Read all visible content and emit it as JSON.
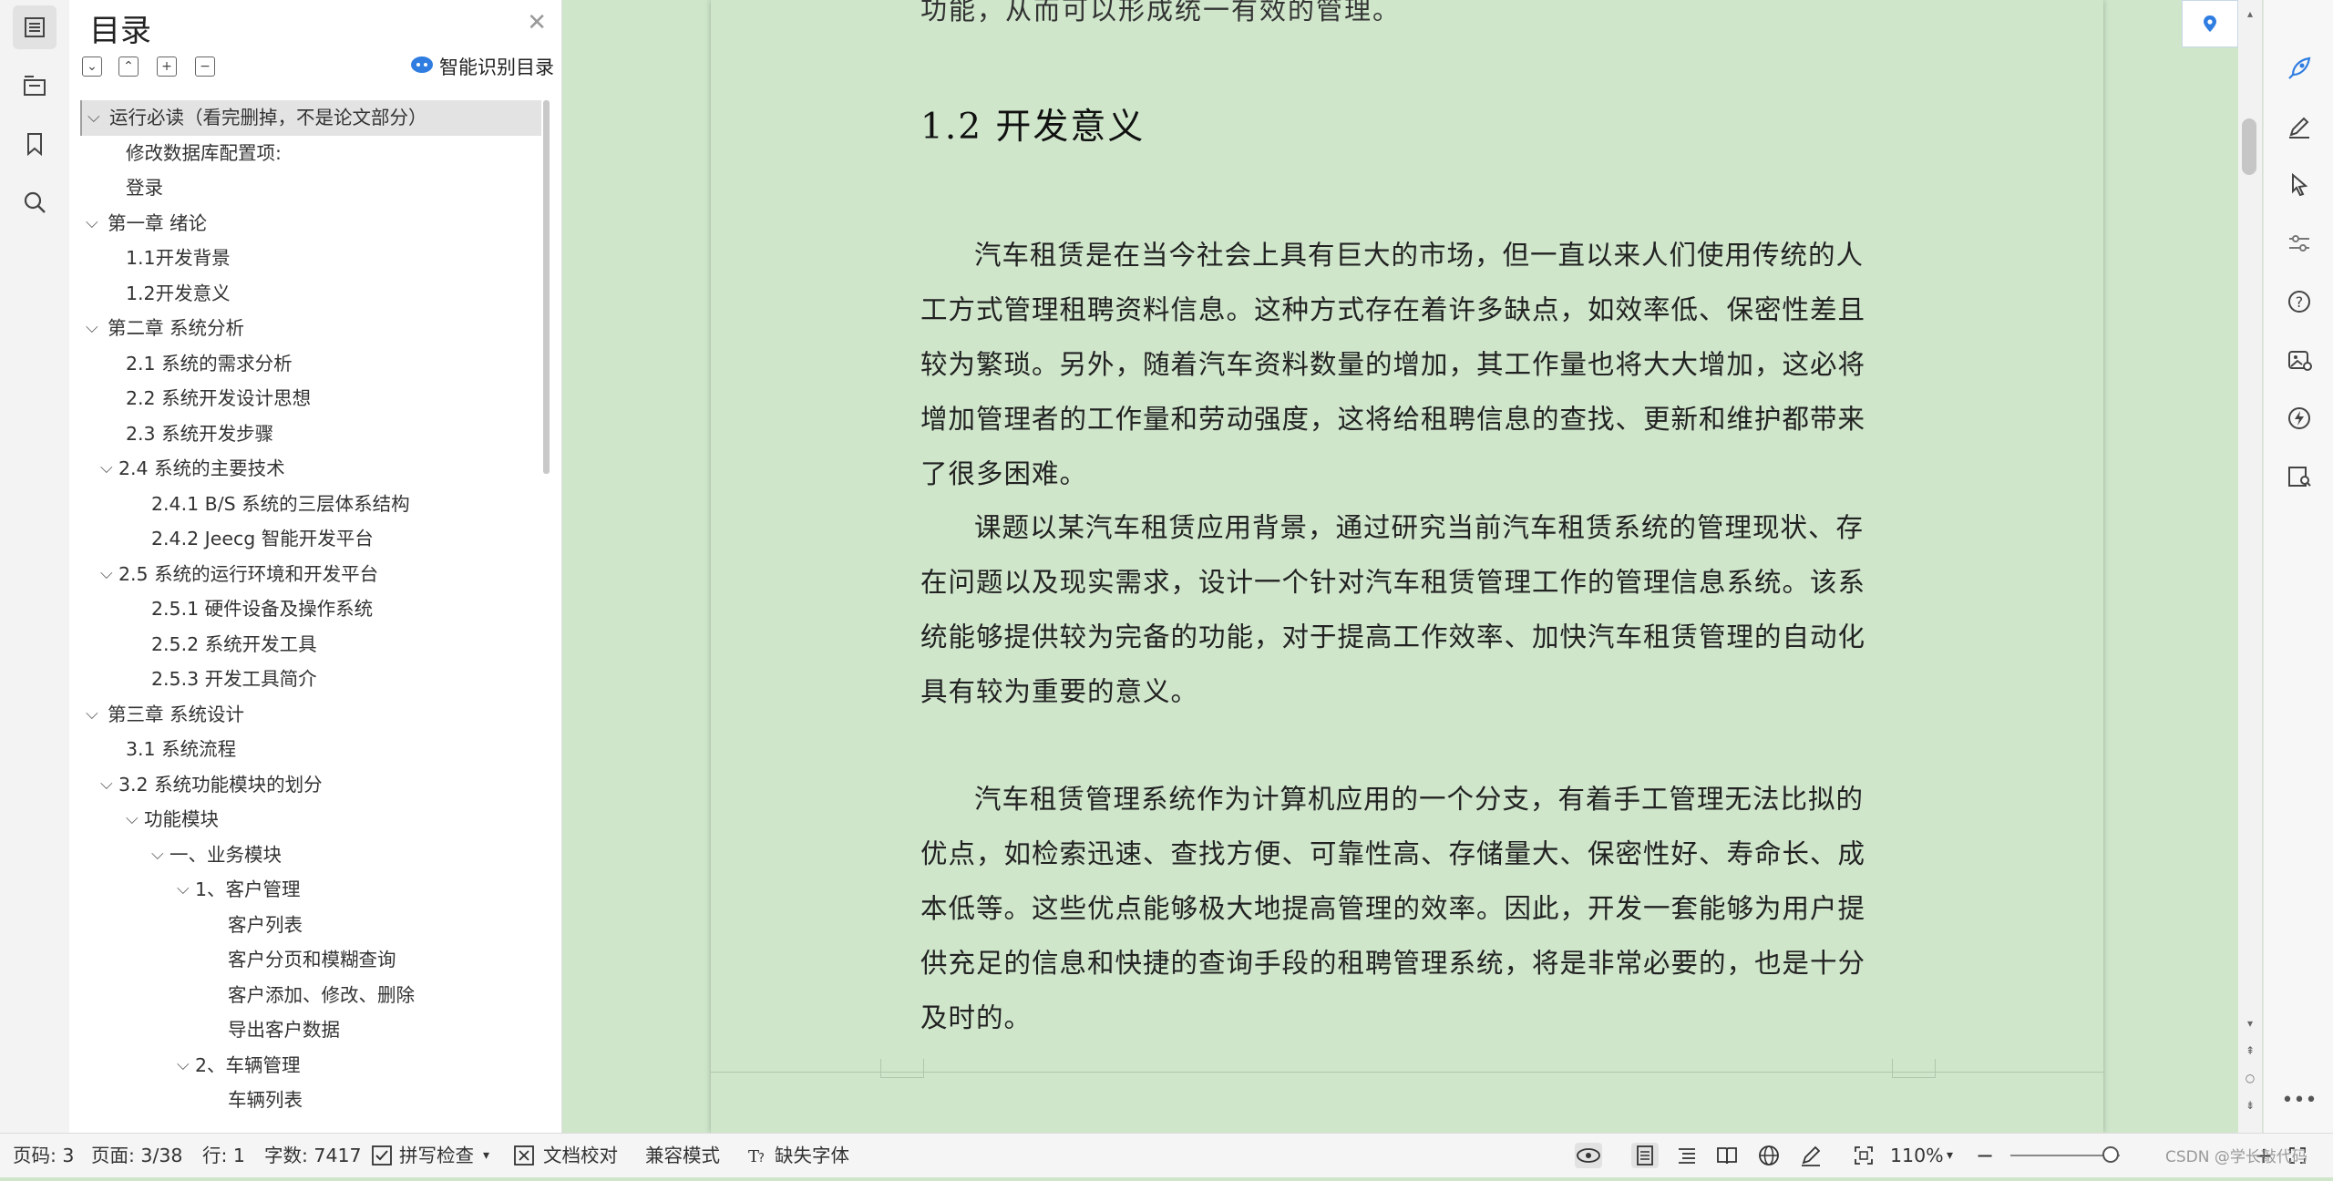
{
  "toc_panel": {
    "title": "目录",
    "smart_toc_label": "智能识别目录",
    "items": [
      {
        "label": "运行必读（看完删掉，不是论文部分）",
        "level": 0,
        "expanded": true,
        "selected": true
      },
      {
        "label": "修改数据库配置项:",
        "level": 1
      },
      {
        "label": "登录",
        "level": 1
      },
      {
        "label": "第一章  绪论",
        "level": 0,
        "expanded": true
      },
      {
        "label": "1.1开发背景",
        "level": 1
      },
      {
        "label": "1.2开发意义",
        "level": 1
      },
      {
        "label": "第二章  系统分析",
        "level": 0,
        "expanded": true
      },
      {
        "label": "2.1  系统的需求分析",
        "level": 1
      },
      {
        "label": "2.2  系统开发设计思想",
        "level": 1
      },
      {
        "label": "2.3 系统开发步骤",
        "level": 1
      },
      {
        "label": "2.4  系统的主要技术",
        "level": 1,
        "expanded": true
      },
      {
        "label": "2.4.1 B/S 系统的三层体系结构",
        "level": 2
      },
      {
        "label": "2.4.2 Jeecg  智能开发平台",
        "level": 2
      },
      {
        "label": "2.5  系统的运行环境和开发平台",
        "level": 1,
        "expanded": true
      },
      {
        "label": "2.5.1  硬件设备及操作系统",
        "level": 2
      },
      {
        "label": "2.5.2  系统开发工具",
        "level": 2
      },
      {
        "label": "2.5.3  开发工具简介",
        "level": 2
      },
      {
        "label": "第三章  系统设计",
        "level": 0,
        "expanded": true
      },
      {
        "label": "3.1 系统流程",
        "level": 1
      },
      {
        "label": "3.2  系统功能模块的划分",
        "level": 1,
        "expanded": true
      },
      {
        "label": "功能模块",
        "level": 2,
        "expanded": true
      },
      {
        "label": "一、业务模块",
        "level": 3,
        "expanded": true
      },
      {
        "label": "1、客户管理",
        "level": 4,
        "expanded": true
      },
      {
        "label": "客户列表",
        "level": 5
      },
      {
        "label": "客户分页和模糊查询",
        "level": 5
      },
      {
        "label": "客户添加、修改、删除",
        "level": 5
      },
      {
        "label": "导出客户数据",
        "level": 5
      },
      {
        "label": "2、车辆管理",
        "level": 4,
        "expanded": true
      },
      {
        "label": "车辆列表",
        "level": 5
      }
    ]
  },
  "document": {
    "cut_line": "功能，从而可以形成统一有效的管理。",
    "section_heading": "1.2  开发意义",
    "paragraphs": [
      "汽车租赁是在当今社会上具有巨大的市场，但一直以来人们使用传统的人工方式管理租聘资料信息。这种方式存在着许多缺点，如效率低、保密性差且较为繁琐。另外，随着汽车资料数量的增加，其工作量也将大大增加，这必将增加管理者的工作量和劳动强度，这将给租聘信息的查找、更新和维护都带来了很多困难。",
      "课题以某汽车租赁应用背景，通过研究当前汽车租赁系统的管理现状、存在问题以及现实需求，设计一个针对汽车租赁管理工作的管理信息系统。该系统能够提供较为完备的功能，对于提高工作效率、加快汽车租赁管理的自动化具有较为重要的意义。",
      "汽车租赁管理系统作为计算机应用的一个分支，有着手工管理无法比拟的优点，如检索迅速、查找方便、可靠性高、存储量大、保密性好、寿命长、成本低等。这些优点能够极大地提高管理的效率。因此，开发一套能够为用户提供充足的信息和快捷的查询手段的租聘管理系统，将是非常必要的，也是十分及时的。"
    ]
  },
  "status_bar": {
    "page_code": "页码: 3",
    "page": "页面: 3/38",
    "row": "行: 1",
    "word_count": "字数: 7417",
    "spell_check": "拼写检查",
    "doc_proof": "文档校对",
    "compat_mode": "兼容模式",
    "missing_font": "缺失字体",
    "zoom": "110%",
    "zoom_fraction": 0.92,
    "watermark": "CSDN @学长敲代码"
  },
  "colors": {
    "page_background": "#cfe6cb",
    "accent": "#2f7de1"
  },
  "icons": {
    "left_rail": [
      "toc-icon",
      "navigation-icon",
      "bookmark-icon",
      "search-icon"
    ],
    "right_rail": [
      "rocket-icon",
      "pen-icon",
      "pointer-icon",
      "sliders-icon",
      "help-icon",
      "image-edit-icon",
      "lightning-icon",
      "read-mode-icon"
    ]
  }
}
